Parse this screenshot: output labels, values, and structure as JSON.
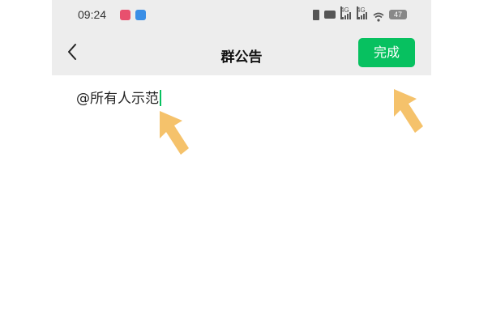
{
  "status_bar": {
    "time": "09:24",
    "network_left": "4G",
    "network_right": "4G",
    "battery": "47"
  },
  "nav": {
    "title": "群公告",
    "done_label": "完成"
  },
  "editor": {
    "text": "@所有人示范"
  },
  "colors": {
    "accent": "#07c160",
    "bar_bg": "#ededed",
    "arrow": "#f5c26b"
  },
  "icons": [
    "back-chevron-icon",
    "vibrate-icon",
    "hd-icon",
    "signal-icon",
    "wifi-icon",
    "battery-icon",
    "annotation-arrow-icon"
  ]
}
